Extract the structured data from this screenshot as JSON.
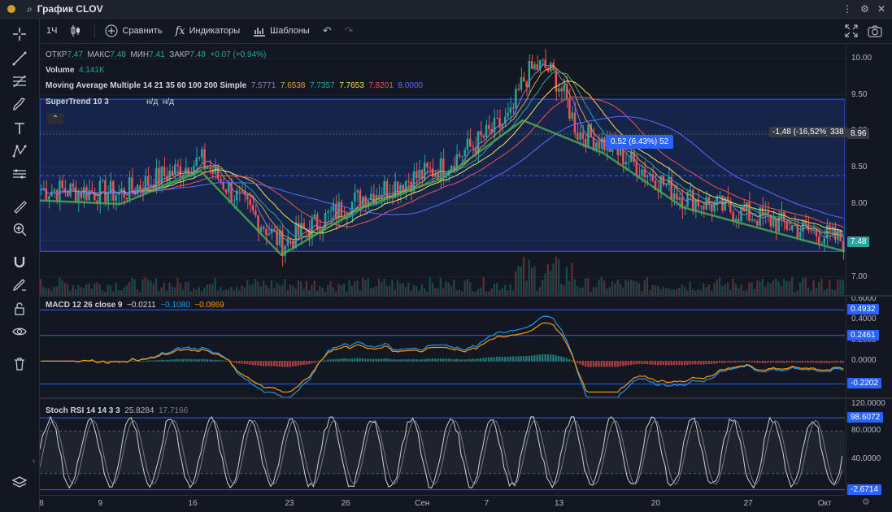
{
  "window": {
    "title": "График CLOV",
    "controls": [
      "⋮",
      "⚙",
      "✕"
    ]
  },
  "toolbar": {
    "interval": "1Ч",
    "compare": "Сравнить",
    "indicators": "Индикаторы",
    "templates": "Шаблоны"
  },
  "legend": {
    "ohlc_open_label": "ОТКР",
    "ohlc_open": "7.47",
    "ohlc_high_label": "МАКС",
    "ohlc_high": "7.48",
    "ohlc_low_label": "МИН",
    "ohlc_low": "7.41",
    "ohlc_close_label": "ЗАКР",
    "ohlc_close": "7.48",
    "ohlc_change": "+0.07 (+0.94%)",
    "volume_label": "Volume",
    "volume_value": "4.141K",
    "ma_label": "Moving Average Multiple 14 21 35 60 100 200 Simple",
    "ma_values": [
      {
        "value": "7.5771",
        "color": "#8e7cc3"
      },
      {
        "value": "7.6538",
        "color": "#e0a040"
      },
      {
        "value": "7.7357",
        "color": "#26a69a"
      },
      {
        "value": "7.7653",
        "color": "#f5e04a"
      },
      {
        "value": "7.8201",
        "color": "#ef5350"
      },
      {
        "value": "8.0000",
        "color": "#5c6bff"
      }
    ],
    "supertrend_label": "SuperTrend 10 3",
    "supertrend_v1": "н/д",
    "supertrend_v2": "н/д"
  },
  "price_axis": {
    "labels": [
      "10.00",
      "9.50",
      "9.00",
      "8.50",
      "8.00",
      "7.50",
      "7.00"
    ],
    "last_price": "7.48",
    "crosshair_price": "8.96",
    "crosshair_info": "-1,48 (-16,52%)",
    "crosshair_bars": "338"
  },
  "callout": {
    "text": "0.52 (6.43%) 52"
  },
  "macd": {
    "label": "MACD 12 26 close 9",
    "v1": "−0.0211",
    "v2": "−0.1080",
    "v3": "−0.0869",
    "axis_labels": [
      "0.6000",
      "0.4000",
      "0.2000",
      "0.0000"
    ],
    "tags": [
      "0.4932",
      "0.2461",
      "-0.2202"
    ]
  },
  "stoch": {
    "label": "Stoch RSI 14 14 3 3",
    "v1": "25.8284",
    "v2": "17.7166",
    "axis_labels": [
      "120.0000",
      "80.0000",
      "40.0000"
    ],
    "tags": [
      "98.6072",
      "-2.6714"
    ]
  },
  "time_axis": [
    "8",
    "9",
    "16",
    "23",
    "26",
    "Сен",
    "7",
    "13",
    "20",
    "27",
    "Окт"
  ],
  "colors": {
    "background": "#131722",
    "up": "#26a69a",
    "down": "#ef5350",
    "box": "#2962ff",
    "macd": "#2196f3",
    "signal": "#ff9800",
    "stoch": "#b2b5be"
  },
  "chart_data": {
    "type": "line",
    "symbol": "CLOV",
    "interval": "1Ч",
    "price_range": [
      6.75,
      10.2
    ],
    "price_ticks": [
      7.0,
      7.5,
      8.0,
      8.5,
      9.0,
      9.5,
      10.0
    ],
    "range_box": [
      7.35,
      9.44
    ],
    "horizontal_levels": [
      8.96,
      8.39
    ],
    "series": [
      {
        "name": "SuperTrend 10 3",
        "x": [
          "8",
          "9",
          "16",
          "23",
          "26",
          "Сен",
          "7",
          "13",
          "20",
          "27",
          "Окт"
        ],
        "values": [
          8.2,
          8.15,
          8.6,
          7.45,
          8.1,
          8.5,
          9.3,
          8.85,
          8.1,
          7.8,
          7.5
        ]
      }
    ],
    "macd": {
      "axis_range": [
        -0.35,
        0.62
      ],
      "levels": [
        0.4932,
        0.2461,
        -0.2202
      ],
      "last": {
        "macd": -0.108,
        "signal": -0.0869,
        "histogram": -0.0211
      }
    },
    "stoch_rsi": {
      "axis_range": [
        -10,
        125
      ],
      "levels": [
        98.6072,
        -2.6714
      ],
      "last": {
        "k": 25.8284,
        "d": 17.7166
      }
    }
  }
}
